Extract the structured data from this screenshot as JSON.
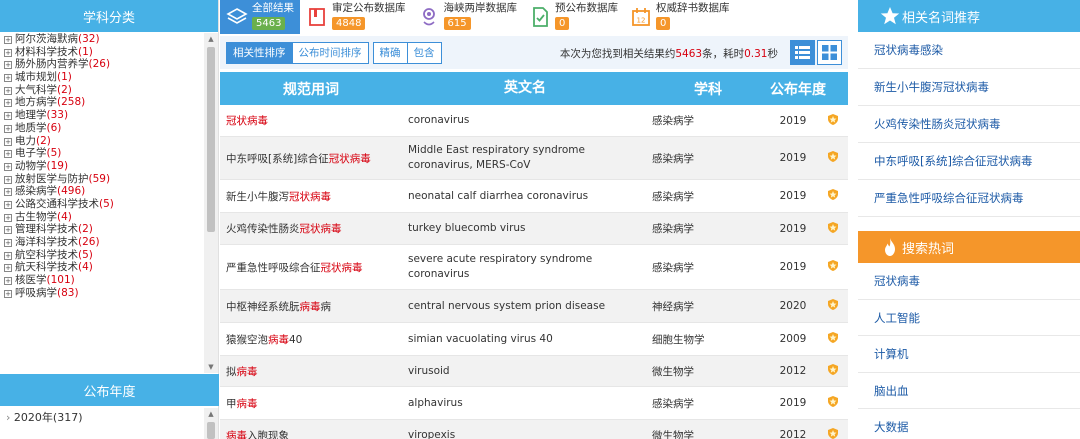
{
  "left": {
    "subject_heading": "学科分类",
    "subjects": [
      {
        "name": "阿尔茨海默病",
        "count": "(32)"
      },
      {
        "name": "材料科学技术",
        "count": "(1)"
      },
      {
        "name": "肠外肠内营养学",
        "count": "(26)"
      },
      {
        "name": "城市规划",
        "count": "(1)"
      },
      {
        "name": "大气科学",
        "count": "(2)"
      },
      {
        "name": "地方病学",
        "count": "(258)"
      },
      {
        "name": "地理学",
        "count": "(33)"
      },
      {
        "name": "地质学",
        "count": "(6)"
      },
      {
        "name": "电力",
        "count": "(2)"
      },
      {
        "name": "电子学",
        "count": "(5)"
      },
      {
        "name": "动物学",
        "count": "(19)"
      },
      {
        "name": "放射医学与防护",
        "count": "(59)"
      },
      {
        "name": "感染病学",
        "count": "(496)"
      },
      {
        "name": "公路交通科学技术",
        "count": "(5)"
      },
      {
        "name": "古生物学",
        "count": "(4)"
      },
      {
        "name": "管理科学技术",
        "count": "(2)"
      },
      {
        "name": "海洋科学技术",
        "count": "(26)"
      },
      {
        "name": "航空科学技术",
        "count": "(5)"
      },
      {
        "name": "航天科学技术",
        "count": "(4)"
      },
      {
        "name": "核医学",
        "count": "(101)"
      },
      {
        "name": "呼吸病学",
        "count": "(83)"
      }
    ],
    "year_heading": "公布年度",
    "years": [
      {
        "name": "2020年",
        "count": "(317)"
      }
    ]
  },
  "dbtabs": [
    {
      "name": "全部结果",
      "count": "5463",
      "badge_color": "#6ab04c",
      "icon": "layers-icon",
      "active": true
    },
    {
      "name": "审定公布数据库",
      "count": "4848",
      "badge_color": "#f5962a",
      "icon": "book-icon",
      "active": false
    },
    {
      "name": "海峡两岸数据库",
      "count": "615",
      "badge_color": "#f5962a",
      "icon": "location-pin-icon",
      "active": false
    },
    {
      "name": "预公布数据库",
      "count": "0",
      "badge_color": "#f5962a",
      "icon": "document-icon",
      "active": false
    },
    {
      "name": "权威辞书数据库",
      "count": "0",
      "badge_color": "#f5962a",
      "icon": "calendar-book-icon",
      "active": false
    }
  ],
  "toolbar": {
    "sort_relevance": "相关性排序",
    "sort_time": "公布时间排序",
    "exact": "精确",
    "contains": "包含",
    "result_prefix": "本次为您找到相关结果约",
    "result_count": "5463",
    "result_mid": "条，耗时",
    "result_time": "0.31",
    "result_suffix": "秒"
  },
  "table": {
    "headers": {
      "term": "规范用词",
      "english": "英文名",
      "subject": "学科",
      "year": "公布年度"
    },
    "rows": [
      {
        "pre": "",
        "hl": "冠状病毒",
        "post": "",
        "english": "coronavirus",
        "subject": "感染病学",
        "year": "2019"
      },
      {
        "pre": "中东呼吸[系统]综合征",
        "hl": "冠状病毒",
        "post": "",
        "english": "Middle East respiratory syndrome coronavirus, MERS-CoV",
        "subject": "感染病学",
        "year": "2019"
      },
      {
        "pre": "新生小牛腹泻",
        "hl": "冠状病毒",
        "post": "",
        "english": "neonatal calf diarrhea coronavirus",
        "subject": "感染病学",
        "year": "2019"
      },
      {
        "pre": "火鸡传染性肠炎",
        "hl": "冠状病毒",
        "post": "",
        "english": "turkey bluecomb virus",
        "subject": "感染病学",
        "year": "2019"
      },
      {
        "pre": "严重急性呼吸综合征",
        "hl": "冠状病毒",
        "post": "",
        "english": "severe acute respiratory syndrome coronavirus",
        "subject": "感染病学",
        "year": "2019"
      },
      {
        "pre": "中枢神经系统朊",
        "hl": "病毒",
        "post": "病",
        "english": "central nervous system prion disease",
        "subject": "神经病学",
        "year": "2020"
      },
      {
        "pre": "猿猴空泡",
        "hl": "病毒",
        "post": "40",
        "english": "simian vacuolating virus 40",
        "subject": "细胞生物学",
        "year": "2009"
      },
      {
        "pre": "拟",
        "hl": "病毒",
        "post": "",
        "english": "virusoid",
        "subject": "微生物学",
        "year": "2012"
      },
      {
        "pre": "甲",
        "hl": "病毒",
        "post": "",
        "english": "alphavirus",
        "subject": "感染病学",
        "year": "2019"
      },
      {
        "pre": "",
        "hl": "病毒",
        "post": "入胞现象",
        "english": "viropexis",
        "subject": "微生物学",
        "year": "2012"
      }
    ]
  },
  "right": {
    "related_heading": "相关名词推荐",
    "related": [
      "冠状病毒感染",
      "新生小牛腹泻冠状病毒",
      "火鸡传染性肠炎冠状病毒",
      "中东呼吸[系统]综合征冠状病毒",
      "严重急性呼吸综合征冠状病毒"
    ],
    "hot_heading": "搜索热词",
    "hot": [
      "冠状病毒",
      "人工智能",
      "计算机",
      "脑出血",
      "大数据"
    ]
  },
  "colors": {
    "accent": "#47b1e6",
    "active_blue": "#3d8fd8",
    "highlight_red": "#d7000f",
    "orange": "#f5962a"
  }
}
